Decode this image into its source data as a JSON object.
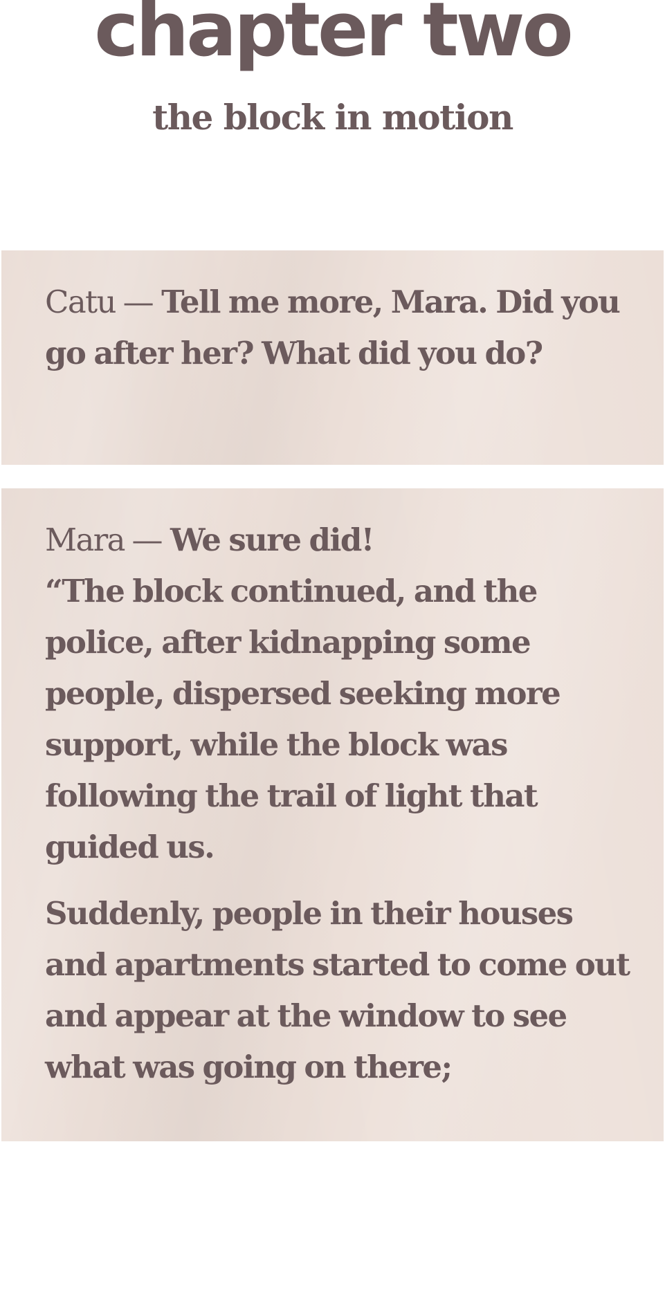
{
  "header": {
    "title": "chapter two",
    "subtitle": "the block in motion"
  },
  "dialogue": [
    {
      "speaker": "Catu —",
      "text": "Tell me more, Mara. Did you go after her? What did you do?"
    },
    {
      "speaker": "Mara —",
      "first_line": "We sure did!",
      "quote": "“The block continued, and the police, after kidnapping some people, dispersed seeking more support, while the block was following the trail of light that guided us.",
      "continuation": "Suddenly, people in their houses and apartments started to come out and appear at the window to see what was going on there;"
    }
  ],
  "colors": {
    "text": "#6b5a5c",
    "paper": "#ecdfd8",
    "background": "#ffffff"
  }
}
